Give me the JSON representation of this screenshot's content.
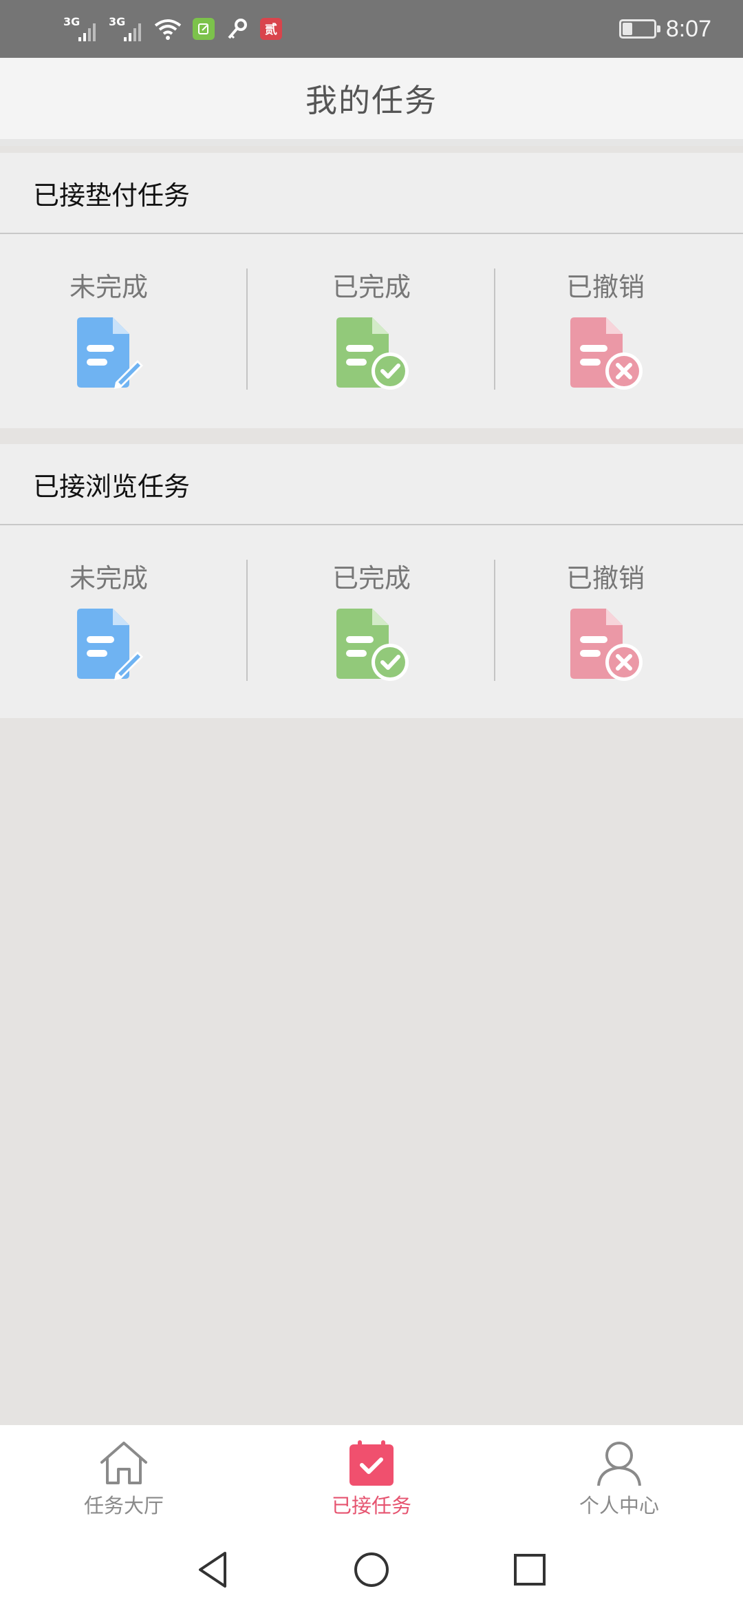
{
  "status_bar": {
    "signal1_label": "3G",
    "signal2_label": "3G",
    "app_badge_text": "贰",
    "battery_level": 0.3,
    "time": "8:07"
  },
  "header": {
    "title": "我的任务"
  },
  "sections": [
    {
      "title": "已接垫付任务",
      "tiles": [
        {
          "label": "未完成",
          "icon": "document-edit-icon",
          "color": "#6fb3f2"
        },
        {
          "label": "已完成",
          "icon": "document-check-icon",
          "color": "#92c97a"
        },
        {
          "label": "已撤销",
          "icon": "document-cancel-icon",
          "color": "#eb98a6"
        }
      ]
    },
    {
      "title": "已接浏览任务",
      "tiles": [
        {
          "label": "未完成",
          "icon": "document-edit-icon",
          "color": "#6fb3f2"
        },
        {
          "label": "已完成",
          "icon": "document-check-icon",
          "color": "#92c97a"
        },
        {
          "label": "已撤销",
          "icon": "document-cancel-icon",
          "color": "#eb98a6"
        }
      ]
    }
  ],
  "tabbar": {
    "tabs": [
      {
        "label": "任务大厅",
        "icon": "home-icon",
        "active": false
      },
      {
        "label": "已接任务",
        "icon": "calendar-check-icon",
        "active": true
      },
      {
        "label": "个人中心",
        "icon": "user-icon",
        "active": false
      }
    ],
    "active_color": "#e65470"
  },
  "navbar": {
    "buttons": [
      "back-icon",
      "home-circle-icon",
      "recents-icon"
    ]
  }
}
